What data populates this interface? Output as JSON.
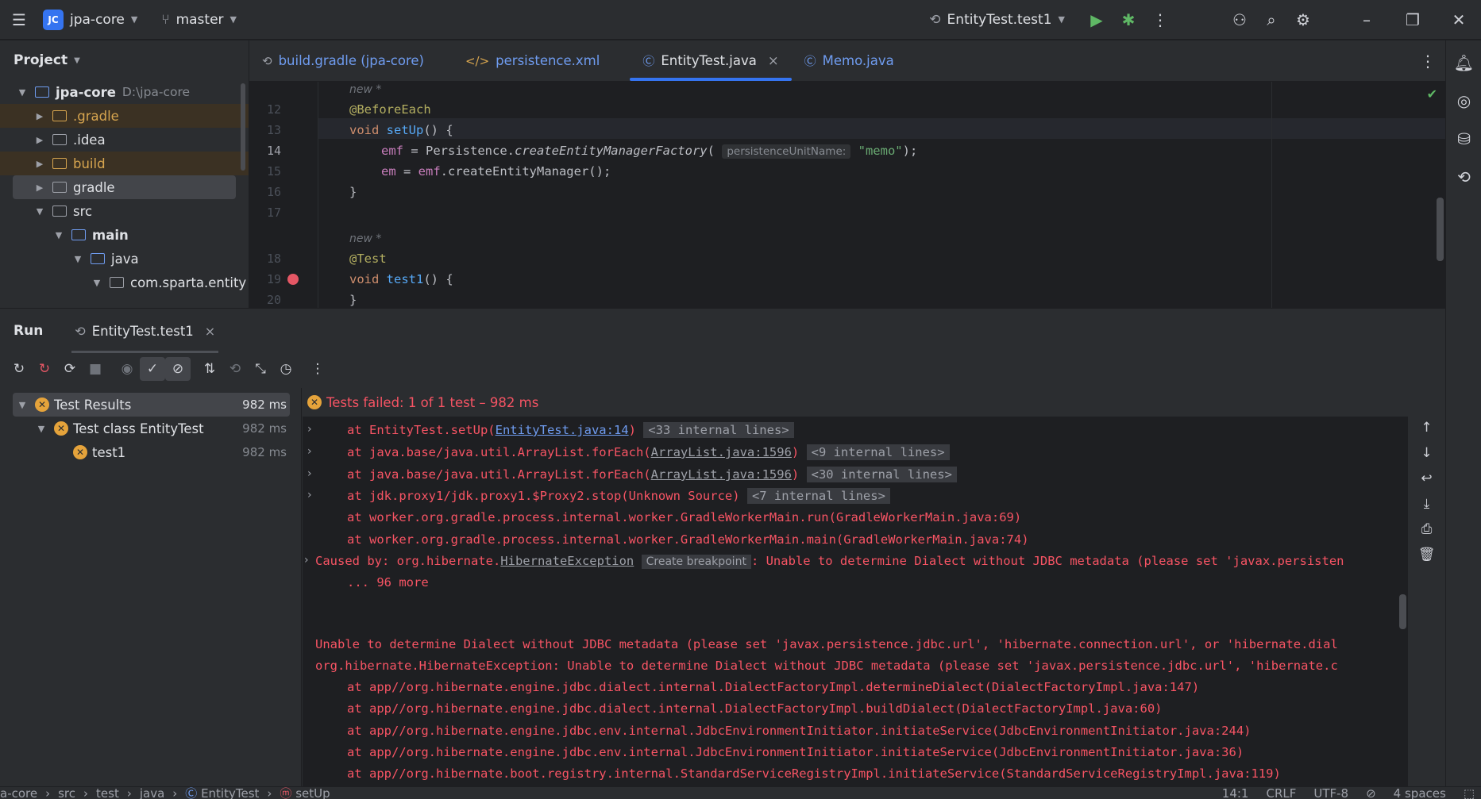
{
  "titlebar": {
    "project_badge": "JC",
    "project_name": "jpa-core",
    "branch": "master",
    "run_config": "EntityTest.test1",
    "icons": [
      "hamburger-menu-icon",
      "branch-icon",
      "run-icon",
      "debug-icon",
      "more-icon",
      "add-user-icon",
      "search-icon",
      "settings-icon",
      "minimize-icon",
      "restore-icon",
      "close-icon"
    ]
  },
  "project_panel": {
    "title": "Project",
    "root_name": "jpa-core",
    "root_path": "D:\\jpa-core",
    "items": [
      {
        "label": ".gradle"
      },
      {
        "label": ".idea"
      },
      {
        "label": "build"
      },
      {
        "label": "gradle"
      },
      {
        "label": "src"
      },
      {
        "label": "main"
      },
      {
        "label": "java"
      },
      {
        "label": "com.sparta.entity"
      }
    ]
  },
  "editor_tabs": [
    {
      "label": "build.gradle (jpa-core)"
    },
    {
      "label": "persistence.xml"
    },
    {
      "label": "EntityTest.java",
      "close": "×"
    },
    {
      "label": "Memo.java"
    }
  ],
  "editor": {
    "hint1": "new *",
    "hint2": "new *",
    "lines": {
      "n12": "12",
      "n13": "13",
      "n14": "14",
      "n15": "15",
      "n16": "16",
      "n17": "17",
      "n18": "18",
      "n19": "19",
      "n20": "20"
    },
    "code": {
      "l12": "@BeforeEach",
      "l13_kw": "void",
      "l13_fn": "setUp",
      "l13_rest": "() {",
      "l14_fld": "emf",
      "l14_mid": " = Persistence.",
      "l14_fn": "createEntityManagerFactory",
      "l14_paren": "(",
      "l14_hint": "persistenceUnitName:",
      "l14_str": "\"memo\"",
      "l14_end": ");",
      "l15_fld": "em",
      "l15_mid": " = ",
      "l15_fld2": "emf",
      "l15_rest": ".createEntityManager();",
      "l16": "}",
      "l18": "@Test",
      "l19_kw": "void",
      "l19_fn": "test1",
      "l19_rest": "() {",
      "l20": "}"
    }
  },
  "run_panel": {
    "title": "Run",
    "tab_label": "EntityTest.test1",
    "tab_close": "×",
    "status": "Tests failed: 1 of 1 test – 982 ms",
    "tree": [
      {
        "label": "Test Results",
        "time": "982 ms"
      },
      {
        "label": "Test class EntityTest",
        "time": "982 ms"
      },
      {
        "label": "test1",
        "time": "982 ms"
      }
    ],
    "console": {
      "c1_pre": "at EntityTest.setUp(",
      "c1_link": "EntityTest.java:14",
      "c1_post": ")",
      "c1_fold": "<33 internal lines>",
      "c2_pre": "at java.base/java.util.ArrayList.forEach(",
      "c2_link": "ArrayList.java:1596",
      "c2_post": ")",
      "c2_fold": "<9 internal lines>",
      "c3_pre": "at java.base/java.util.ArrayList.forEach(",
      "c3_link": "ArrayList.java:1596",
      "c3_post": ")",
      "c3_fold": "<30 internal lines>",
      "c4_pre": "at jdk.proxy1/jdk.proxy1.$Proxy2.stop(Unknown Source)",
      "c4_fold": "<7 internal lines>",
      "c5": "at worker.org.gradle.process.internal.worker.GradleWorkerMain.run(GradleWorkerMain.java:69)",
      "c6": "at worker.org.gradle.process.internal.worker.GradleWorkerMain.main(GradleWorkerMain.java:74)",
      "c7_pre": "Caused by: org.hibernate.",
      "c7_link": "HibernateException",
      "c7_cb": "Create breakpoint",
      "c7_post": ": Unable to determine Dialect without JDBC metadata (please set 'javax.persisten",
      "c8": "... 96 more",
      "c9": "Unable to determine Dialect without JDBC metadata (please set 'javax.persistence.jdbc.url', 'hibernate.connection.url', or 'hibernate.dial",
      "c10": "org.hibernate.HibernateException: Unable to determine Dialect without JDBC metadata (please set 'javax.persistence.jdbc.url', 'hibernate.c",
      "c11": "at app//org.hibernate.engine.jdbc.dialect.internal.DialectFactoryImpl.determineDialect(DialectFactoryImpl.java:147)",
      "c12": "at app//org.hibernate.engine.jdbc.dialect.internal.DialectFactoryImpl.buildDialect(DialectFactoryImpl.java:60)",
      "c13": "at app//org.hibernate.engine.jdbc.env.internal.JdbcEnvironmentInitiator.initiateService(JdbcEnvironmentInitiator.java:244)",
      "c14": "at app//org.hibernate.engine.jdbc.env.internal.JdbcEnvironmentInitiator.initiateService(JdbcEnvironmentInitiator.java:36)",
      "c15": "at app//org.hibernate.boot.registry.internal.StandardServiceRegistryImpl.initiateService(StandardServiceRegistryImpl.java:119)"
    }
  },
  "statusbar": {
    "b1": "a-core",
    "b2": "src",
    "b3": "test",
    "b4": "java",
    "b5": "EntityTest",
    "b6": "setUp",
    "pos": "14:1",
    "eol": "CRLF",
    "enc": "UTF-8",
    "indent": "4 spaces"
  },
  "colors": {
    "accent": "#3574f0",
    "error": "#f75464",
    "warning": "#e5a33b",
    "run": "#5fb865"
  }
}
